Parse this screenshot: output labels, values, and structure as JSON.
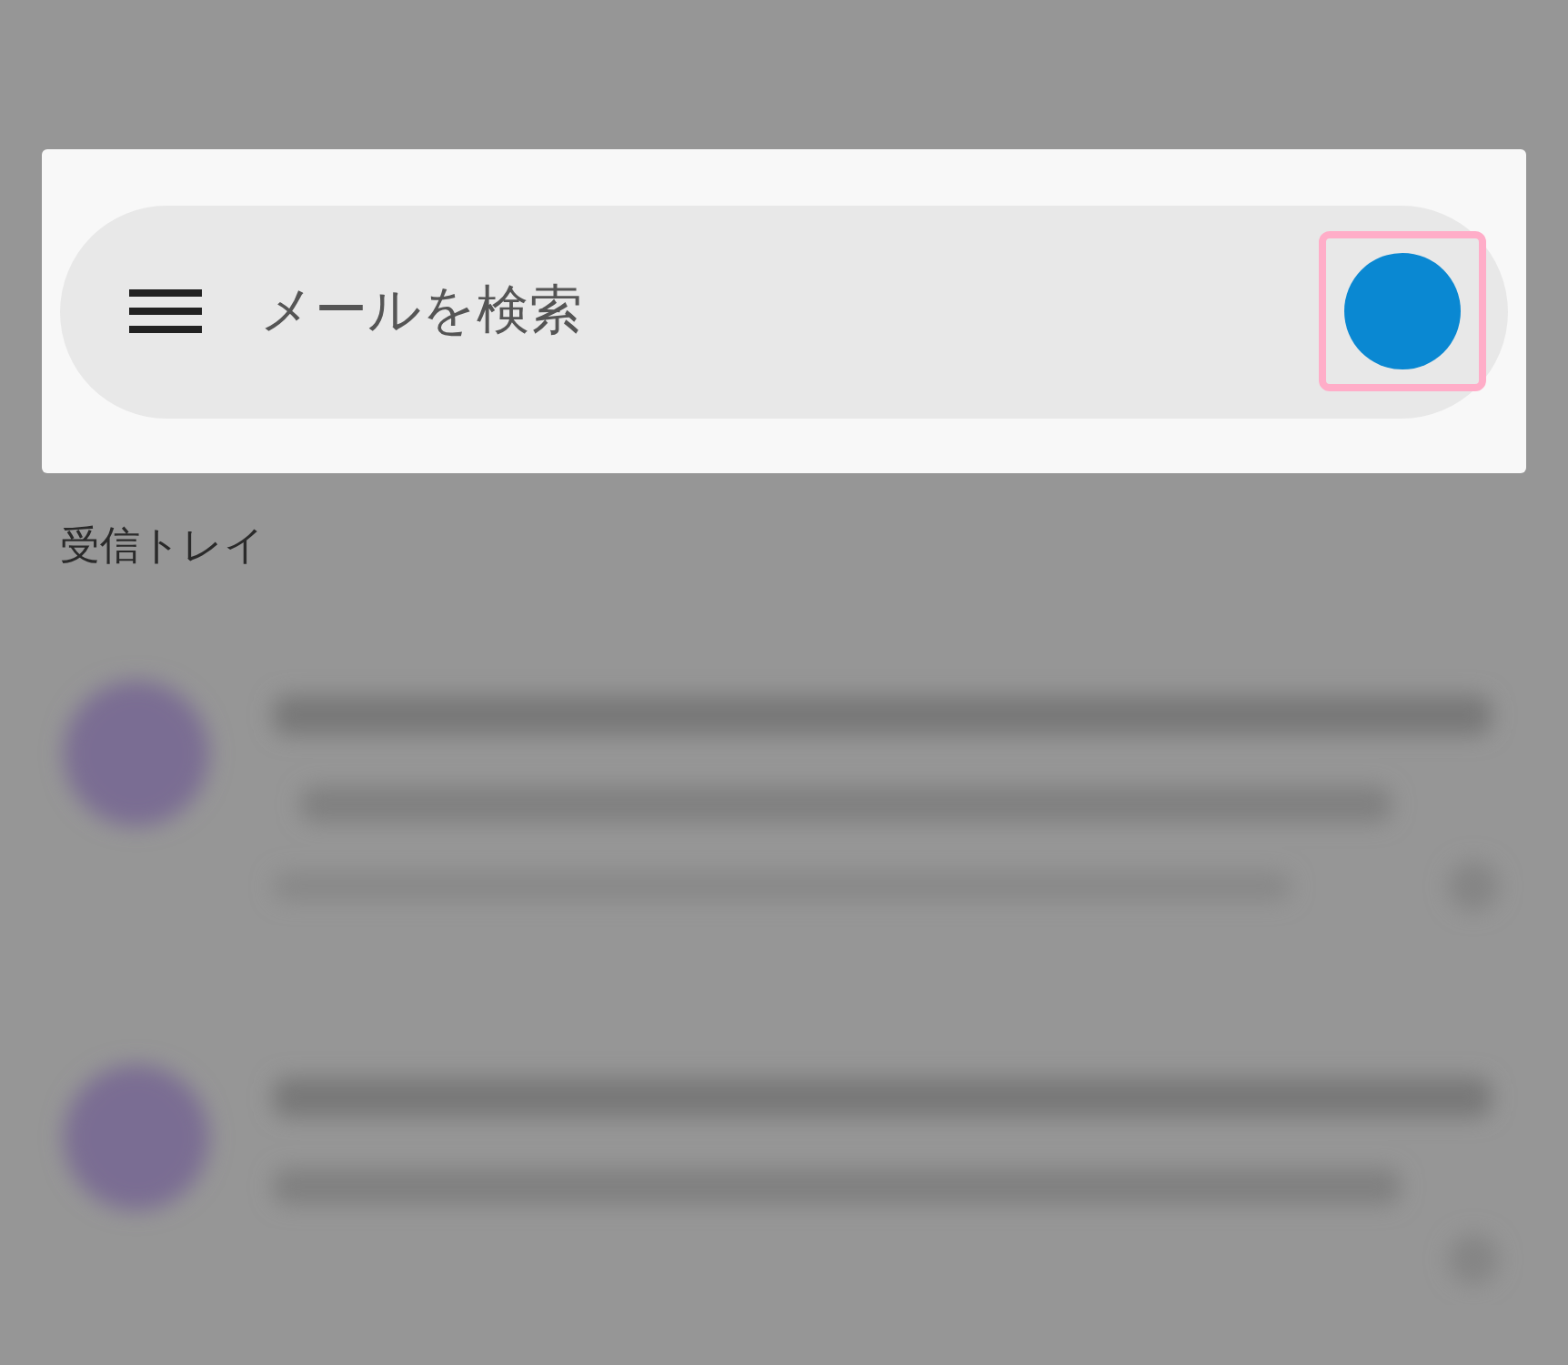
{
  "search_bar": {
    "placeholder": "メールを検索",
    "avatar": {
      "highlighted": true
    }
  },
  "section_label": "受信トレイ"
}
